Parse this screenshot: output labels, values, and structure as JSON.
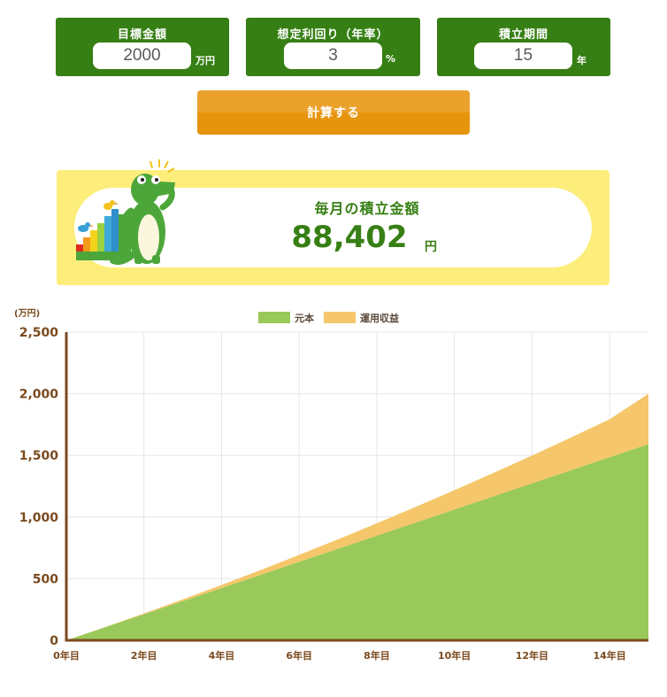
{
  "params": {
    "target": {
      "label": "目標金額",
      "value": "2000",
      "unit": "万円"
    },
    "rate": {
      "label": "想定利回り（年率）",
      "value": "3",
      "unit": "%"
    },
    "years": {
      "label": "積立期間",
      "value": "15",
      "unit": "年"
    }
  },
  "calc_button": "計算する",
  "result": {
    "label": "毎月の積立金額",
    "value": "88,402",
    "unit": "円"
  },
  "colors": {
    "accent_green": "#367f14",
    "button_orange": "#e5940b",
    "panel_yellow": "#fdee7b",
    "principal": "#99c95a",
    "returns": "#f5c76a",
    "axis": "#7a4a1e"
  },
  "chart_data": {
    "type": "area",
    "stacked": true,
    "y_unit_label": "(万円)",
    "x": [
      0,
      1,
      2,
      3,
      4,
      5,
      6,
      7,
      8,
      9,
      10,
      11,
      12,
      13,
      14,
      15
    ],
    "x_tick_labels": [
      "0年目",
      "2年目",
      "4年目",
      "6年目",
      "8年目",
      "10年目",
      "12年目",
      "14年目"
    ],
    "y_tick_labels": [
      "0",
      "500",
      "1,000",
      "1,500",
      "2,000",
      "2,500"
    ],
    "ylim": [
      0,
      2500
    ],
    "xlim": [
      0,
      15
    ],
    "grid": true,
    "legend_position": "top-center",
    "series": [
      {
        "name": "元本",
        "color": "#99c95a",
        "values": [
          0,
          106,
          212,
          318,
          424,
          530,
          637,
          743,
          849,
          955,
          1061,
          1167,
          1273,
          1379,
          1485,
          1591
        ]
      },
      {
        "name": "運用収益",
        "color": "#f5c76a",
        "values": [
          0,
          2,
          6,
          14,
          25,
          39,
          56,
          76,
          100,
          127,
          157,
          190,
          226,
          265,
          308,
          409
        ]
      }
    ]
  }
}
